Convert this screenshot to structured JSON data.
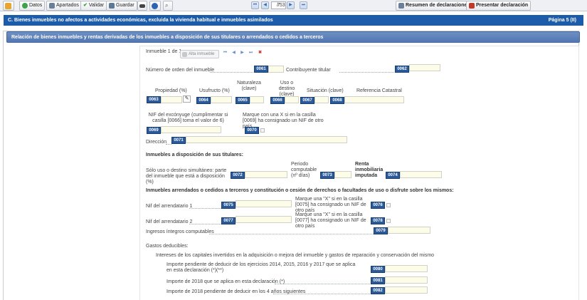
{
  "toolbar": {
    "datos": "Datos",
    "apartados": "Apartados",
    "validar": "Validar",
    "guardar": "Guardar",
    "page_value": "7",
    "page_total": "/ 53",
    "resumen": "Resumen de declaraciones",
    "presentar": "Presentar declaración"
  },
  "section": {
    "title": "C.  Bienes inmuebles no afectos a actividades económicas, excluida la vivienda habitual e inmuebles asimilados",
    "page": "Página 5 (II)"
  },
  "panel": {
    "title": "Relación de bienes inmuebles y rentas derivadas de los inmuebles a disposición de sus titulares o arrendados o cedidos a terceros"
  },
  "inmueble": {
    "counter": "Inmueble 1 de 1",
    "alta": "Alta inmueble"
  },
  "fields": {
    "orden_label": "Número de orden del inmueble",
    "c0061": "0061",
    "titular_label": "Contribuyente titular",
    "c0062": "0062",
    "propiedad_label": "Propiedad (%)",
    "usufructo_label": "Usufructo (%)",
    "naturaleza_label": "Naturaleza (clave)",
    "uso_label": "Uso o destino (clave)",
    "situacion_label": "Situación (clave)",
    "referencia_label": "Referencia Catastral",
    "c0063": "0063",
    "c0064": "0064",
    "c0065": "0065",
    "c0066": "0066",
    "c0067": "0067",
    "c0068": "0068",
    "nif_conyuge_label": "NIF del excónyuge (cumplimentar si casilla [0066] toma el valor de 6)",
    "marque_0069_label": "Marque con una X si en la casilla [0069] ha consignado un NIF de otro país",
    "c0069": "0069",
    "c0070": "0070",
    "direccion_label": "Dirección",
    "c0071": "0071"
  },
  "disposicion": {
    "heading": "Inmuebles a disposición de sus titulares:",
    "solo_uso_label": "Sólo uso o destino simultáneo: parte del inmueble que está a disposición (%)",
    "c0072": "0072",
    "periodo_label": "Periodo computable (nº días)",
    "c0073": "0073",
    "renta_label": "Renta inmobiliaria imputada",
    "c0074": "0074"
  },
  "arrendados": {
    "heading": "Inmuebles arrendados o cedidos a terceros y constitución o cesión de derechos o facultades de uso o disfrute sobre los mismos:",
    "nif1_label": "Nif del arrendatario 1",
    "c0075": "0075",
    "marque_0075_label": "Marque una \"X\" si en la casilla [0075] ha consignado un NIF de otro país",
    "c0076": "0076",
    "nif2_label": "Nif del arrendatario 2",
    "c0077": "0077",
    "marque_0077_label": "Marque una \"X\" si en la casilla [0077] ha consignado un NIF de otro país",
    "c0078": "0078",
    "ingresos_label": "Ingresos íntegros computables",
    "c0079": "0079"
  },
  "gastos": {
    "heading": "Gastos deducibles:",
    "intereses_label": "Intereses de los capitales invertidos en la adquisición o mejora del inmueble y gastos de reparación y conservación del mismo",
    "pendiente_label": "Importe pendiente de deducir de los ejercicios 2014, 2015, 2016 y 2017 que se aplica en esta declaración (*)(**)",
    "c0080": "0080",
    "aplica_label": "Importe de 2018 que se aplica en esta declaración (*)",
    "c0081": "0081",
    "pendiente_2018_label": "Importe de 2018 pendiente de deducir en los 4 años siguientes",
    "c0082": "0082"
  }
}
